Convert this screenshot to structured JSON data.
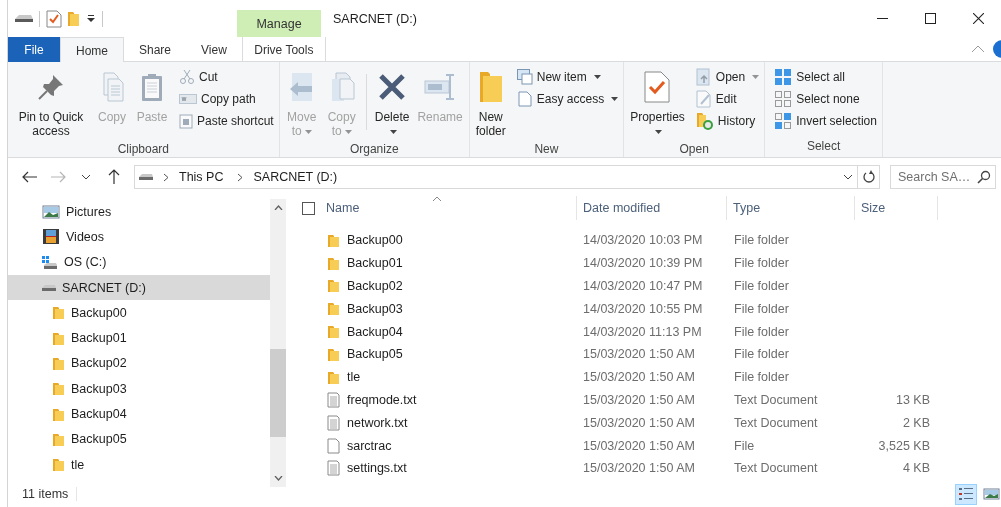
{
  "window": {
    "title": "SARCNET (D:)"
  },
  "tabs": [
    {
      "label": "File",
      "kind": "file",
      "selected": false
    },
    {
      "label": "Home",
      "kind": "plain",
      "selected": true
    },
    {
      "label": "Share",
      "kind": "plain",
      "selected": false
    },
    {
      "label": "View",
      "kind": "plain",
      "selected": false
    },
    {
      "label": "Drive Tools",
      "kind": "contextual",
      "group_label": "Manage",
      "selected": false
    }
  ],
  "ribbon": [
    {
      "label": "Clipboard",
      "items": [
        {
          "kind": "large",
          "label": "Pin to Quick access",
          "disabled": false
        },
        {
          "kind": "large",
          "label": "Copy",
          "disabled": true
        },
        {
          "kind": "large",
          "label": "Paste",
          "disabled": true
        },
        {
          "kind": "small",
          "label": "Cut",
          "disabled": true
        },
        {
          "kind": "small",
          "label": "Copy path",
          "disabled": true
        },
        {
          "kind": "small",
          "label": "Paste shortcut",
          "disabled": true
        }
      ]
    },
    {
      "label": "Organize",
      "items": [
        {
          "kind": "large",
          "label": "Move to",
          "disabled": true,
          "dropdown": true
        },
        {
          "kind": "large",
          "label": "Copy to",
          "disabled": true,
          "dropdown": true
        },
        {
          "kind": "separator"
        },
        {
          "kind": "large",
          "label": "Delete",
          "disabled": false,
          "dropdown": true
        },
        {
          "kind": "large",
          "label": "Rename",
          "disabled": true
        }
      ]
    },
    {
      "label": "New",
      "items": [
        {
          "kind": "large",
          "label": "New folder",
          "disabled": false
        },
        {
          "kind": "small",
          "label": "New item",
          "disabled": false,
          "dropdown": true
        },
        {
          "kind": "small",
          "label": "Easy access",
          "disabled": false,
          "dropdown": true
        }
      ]
    },
    {
      "label": "Open",
      "items": [
        {
          "kind": "large",
          "label": "Properties",
          "disabled": false,
          "dropdown": true
        },
        {
          "kind": "small",
          "label": "Open",
          "disabled": true,
          "dropdown": true
        },
        {
          "kind": "small",
          "label": "Edit",
          "disabled": true
        },
        {
          "kind": "small",
          "label": "History",
          "disabled": false
        }
      ]
    },
    {
      "label": "Select",
      "items": [
        {
          "kind": "small",
          "label": "Select all",
          "disabled": false
        },
        {
          "kind": "small",
          "label": "Select none",
          "disabled": false
        },
        {
          "kind": "small",
          "label": "Invert selection",
          "disabled": false
        }
      ]
    }
  ],
  "address": {
    "crumbs": [
      "This PC",
      "SARCNET (D:)"
    ]
  },
  "search": {
    "placeholder": "Search SA…"
  },
  "nav": {
    "items": [
      {
        "label": "Pictures",
        "kind": "pictures",
        "selected": false
      },
      {
        "label": "Videos",
        "kind": "videos",
        "selected": false
      },
      {
        "label": "OS (C:)",
        "kind": "system-drive",
        "selected": false
      },
      {
        "label": "SARCNET (D:)",
        "kind": "drive",
        "selected": true,
        "children": [
          {
            "label": "Backup00",
            "kind": "folder",
            "selected": false
          },
          {
            "label": "Backup01",
            "kind": "folder",
            "selected": false
          },
          {
            "label": "Backup02",
            "kind": "folder",
            "selected": false
          },
          {
            "label": "Backup03",
            "kind": "folder",
            "selected": false
          },
          {
            "label": "Backup04",
            "kind": "folder",
            "selected": false
          },
          {
            "label": "Backup05",
            "kind": "folder",
            "selected": false
          },
          {
            "label": "tle",
            "kind": "folder",
            "selected": false
          }
        ]
      }
    ]
  },
  "select_all": {
    "checked": false
  },
  "columns": [
    {
      "label": "Name",
      "sorted": true
    },
    {
      "label": "Date modified",
      "sorted": false
    },
    {
      "label": "Type",
      "sorted": false
    },
    {
      "label": "Size",
      "sorted": false
    }
  ],
  "files": [
    {
      "name": "Backup00",
      "kind": "folder",
      "date": "14/03/2020 10:03 PM",
      "type": "File folder"
    },
    {
      "name": "Backup01",
      "kind": "folder",
      "date": "14/03/2020 10:39 PM",
      "type": "File folder"
    },
    {
      "name": "Backup02",
      "kind": "folder",
      "date": "14/03/2020 10:47 PM",
      "type": "File folder"
    },
    {
      "name": "Backup03",
      "kind": "folder",
      "date": "14/03/2020 10:55 PM",
      "type": "File folder"
    },
    {
      "name": "Backup04",
      "kind": "folder",
      "date": "14/03/2020 11:13 PM",
      "type": "File folder"
    },
    {
      "name": "Backup05",
      "kind": "folder",
      "date": "15/03/2020 1:50 AM",
      "type": "File folder"
    },
    {
      "name": "tle",
      "kind": "folder",
      "date": "15/03/2020 1:50 AM",
      "type": "File folder"
    },
    {
      "name": "freqmode.txt",
      "kind": "text",
      "date": "15/03/2020 1:50 AM",
      "type": "Text Document",
      "size": "13 KB"
    },
    {
      "name": "network.txt",
      "kind": "text",
      "date": "15/03/2020 1:50 AM",
      "type": "Text Document",
      "size": "2 KB"
    },
    {
      "name": "sarctrac",
      "kind": "file",
      "date": "15/03/2020 1:50 AM",
      "type": "File",
      "size": "3,525 KB"
    },
    {
      "name": "settings.txt",
      "kind": "text",
      "date": "15/03/2020 1:50 AM",
      "type": "Text Document",
      "size": "4 KB"
    }
  ],
  "status": {
    "count": "11 items",
    "views": [
      {
        "kind": "details",
        "selected": true
      },
      {
        "kind": "large-icons",
        "selected": false
      }
    ]
  }
}
